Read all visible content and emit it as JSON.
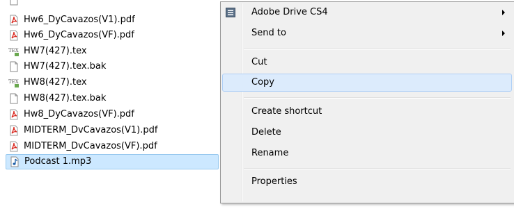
{
  "files": [
    {
      "name": "Hw6_DyCavazos(V1).pdf",
      "icon": "pdf-icon",
      "selected": false
    },
    {
      "name": "Hw6_DyCavazos(VF).pdf",
      "icon": "pdf-icon",
      "selected": false
    },
    {
      "name": "HW7(427).tex",
      "icon": "tex-icon",
      "selected": false
    },
    {
      "name": "HW7(427).tex.bak",
      "icon": "blank-file-icon",
      "selected": false
    },
    {
      "name": "HW8(427).tex",
      "icon": "tex-icon",
      "selected": false
    },
    {
      "name": "HW8(427).tex.bak",
      "icon": "blank-file-icon",
      "selected": false
    },
    {
      "name": "Hw8_DyCavazos(VF).pdf",
      "icon": "pdf-icon",
      "selected": false
    },
    {
      "name": "MIDTERM_DvCavazos(V1).pdf",
      "icon": "pdf-icon",
      "selected": false
    },
    {
      "name": "MIDTERM_DvCavazos(VF).pdf",
      "icon": "pdf-icon",
      "selected": false
    },
    {
      "name": "Podcast 1.mp3",
      "icon": "audio-file-icon",
      "selected": true
    }
  ],
  "context_menu": {
    "items": {
      "adobe_drive": {
        "label": "Adobe Drive CS4",
        "icon": "adobe-drive-icon",
        "has_submenu": true
      },
      "send_to": {
        "label": "Send to",
        "has_submenu": true
      },
      "cut": {
        "label": "Cut"
      },
      "copy": {
        "label": "Copy",
        "highlighted": true
      },
      "create_shortcut": {
        "label": "Create shortcut"
      },
      "delete": {
        "label": "Delete"
      },
      "rename": {
        "label": "Rename"
      },
      "properties": {
        "label": "Properties"
      }
    }
  },
  "colors": {
    "selection_bg": "#cce8ff",
    "menu_bg": "#f0f0f0",
    "menu_highlight": "#dcebfc",
    "pdf_red": "#d9251c"
  }
}
